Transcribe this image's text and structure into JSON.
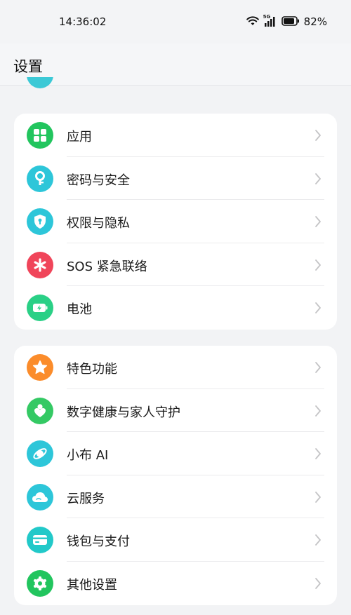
{
  "status_bar": {
    "time": "14:36:02",
    "network": "5G",
    "battery": "82%"
  },
  "header": {
    "title": "设置"
  },
  "groups": [
    {
      "items": [
        {
          "label": "应用",
          "icon": "apps-grid-icon",
          "color": "#22c55e"
        },
        {
          "label": "密码与安全",
          "icon": "key-icon",
          "color": "#2dc6d9"
        },
        {
          "label": "权限与隐私",
          "icon": "privacy-shield-icon",
          "color": "#2dc6d9"
        },
        {
          "label": "SOS 紧急联络",
          "icon": "sos-asterisk-icon",
          "color": "#f0455a"
        },
        {
          "label": "电池",
          "icon": "battery-icon",
          "color": "#2ad086"
        }
      ]
    },
    {
      "items": [
        {
          "label": "特色功能",
          "icon": "star-icon",
          "color": "#fb8c2b"
        },
        {
          "label": "数字健康与家人守护",
          "icon": "family-heart-icon",
          "color": "#34c964"
        },
        {
          "label": "小布 AI",
          "icon": "ai-orbit-icon",
          "color": "#2dc6d9"
        },
        {
          "label": "云服务",
          "icon": "cloud-icon",
          "color": "#2dc6d9"
        },
        {
          "label": "钱包与支付",
          "icon": "card-icon",
          "color": "#22c9c9"
        },
        {
          "label": "其他设置",
          "icon": "gear-icon",
          "color": "#22c55e"
        }
      ]
    }
  ]
}
